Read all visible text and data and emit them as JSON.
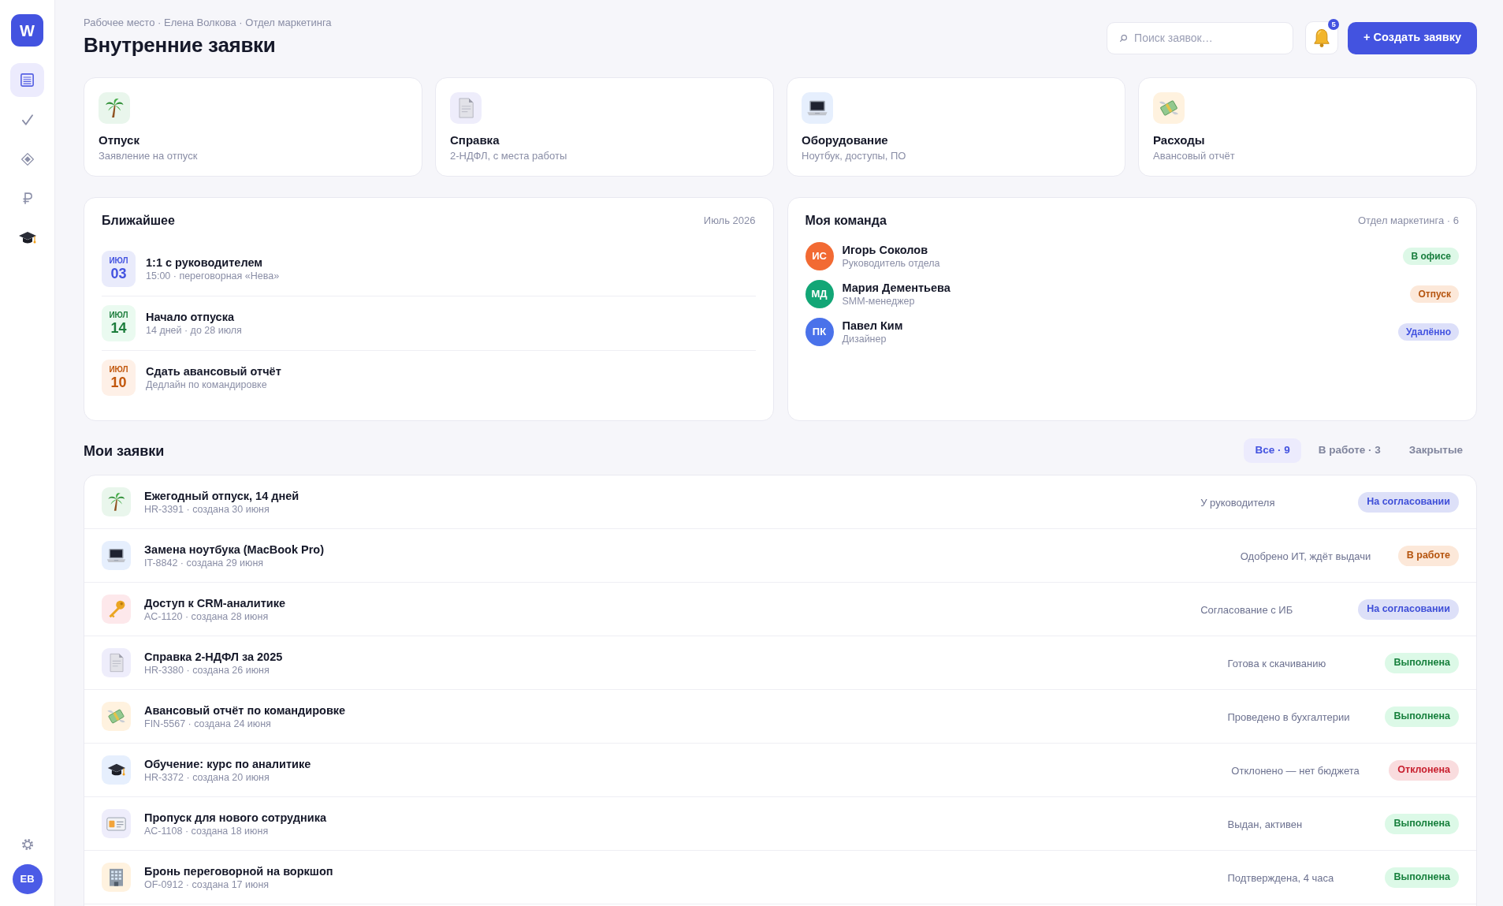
{
  "sidebar": {
    "logo": "W",
    "items": [
      {
        "kind": "list",
        "selected": true
      },
      {
        "kind": "check",
        "selected": false
      },
      {
        "kind": "diamond",
        "selected": false
      },
      {
        "kind": "ruble",
        "selected": false
      },
      {
        "kind": "cap",
        "selected": false
      }
    ],
    "user_initials": "ЕВ"
  },
  "header": {
    "breadcrumb": "Рабочее место · Елена Волкова · Отдел маркетинга",
    "title": "Внутренние заявки",
    "search": {
      "placeholder": "Поиск заявок…"
    },
    "notifications": {
      "count": "5"
    },
    "create_button": "+ Создать заявку"
  },
  "request_types": [
    {
      "kind": "vacation",
      "title": "Отпуск",
      "subtitle": "Заявление на отпуск"
    },
    {
      "kind": "certificate",
      "title": "Справка",
      "subtitle": "2-НДФЛ, с места работы"
    },
    {
      "kind": "equipment",
      "title": "Оборудование",
      "subtitle": "Ноутбук, доступы, ПО"
    },
    {
      "kind": "expense",
      "title": "Расходы",
      "subtitle": "Авансовый отчёт"
    }
  ],
  "upcoming": {
    "title": "Ближайшее",
    "period": "Июль 2026",
    "events": [
      {
        "month": "ИЮЛ",
        "day": "03",
        "color": "#4353e0",
        "title": "1:1 с руководителем",
        "details": "15:00 · переговорная «Нева»"
      },
      {
        "month": "ИЮЛ",
        "day": "14",
        "color": "#1c7d3c",
        "title": "Начало отпуска",
        "details": "14 дней · до 28 июля"
      },
      {
        "month": "ИЮЛ",
        "day": "10",
        "color": "#c2570c",
        "title": "Сдать авансовый отчёт",
        "details": "Дедлайн по командировке"
      }
    ]
  },
  "team": {
    "title": "Моя команда",
    "subtitle": "Отдел маркетинга · 6",
    "members": [
      {
        "initials": "ИС",
        "color": "#f26a33",
        "name": "Игорь Соколов",
        "role": "Руководитель отдела",
        "status": {
          "text": "В офисе",
          "color": "#1a7f3f"
        }
      },
      {
        "initials": "МД",
        "color": "#12a676",
        "name": "Мария Дементьева",
        "role": "SMM-менеджер",
        "status": {
          "text": "Отпуск",
          "color": "#b5540e"
        }
      },
      {
        "initials": "ПК",
        "color": "#4a72ea",
        "name": "Павел Ким",
        "role": "Дизайнер",
        "status": {
          "text": "Удалённо",
          "color": "#4353e0"
        }
      }
    ]
  },
  "my_requests": {
    "title": "Мои заявки",
    "filters": [
      {
        "label": "Все · 9",
        "selected": true
      },
      {
        "label": "В работе · 3",
        "selected": false
      },
      {
        "label": "Закрытые",
        "selected": false
      }
    ],
    "rows": [
      {
        "kind": "vacation",
        "title": "Ежегодный отпуск, 14 дней",
        "meta": "HR-3391 · создана 30 июня",
        "note": "У руководителя",
        "status": {
          "text": "На согласовании",
          "color": "#3f4fd8"
        }
      },
      {
        "kind": "equipment",
        "title": "Замена ноутбука (MacBook Pro)",
        "meta": "IT-8842 · создана 29 июня",
        "note": "Одобрено ИТ, ждёт выдачи",
        "status": {
          "text": "В работе",
          "color": "#b5540e"
        }
      },
      {
        "kind": "access",
        "title": "Доступ к CRM-аналитике",
        "meta": "AC-1120 · создана 28 июня",
        "note": "Согласование с ИБ",
        "status": {
          "text": "На согласовании",
          "color": "#3f4fd8"
        }
      },
      {
        "kind": "certificate",
        "title": "Справка 2-НДФЛ за 2025",
        "meta": "HR-3380 · создана 26 июня",
        "note": "Готова к скачиванию",
        "status": {
          "text": "Выполнена",
          "color": "#17803d"
        }
      },
      {
        "kind": "expense",
        "title": "Авансовый отчёт по командировке",
        "meta": "FIN-5567 · создана 24 июня",
        "note": "Проведено в бухгалтерии",
        "status": {
          "text": "Выполнена",
          "color": "#17803d"
        }
      },
      {
        "kind": "training",
        "title": "Обучение: курс по аналитике",
        "meta": "HR-3372 · создана 20 июня",
        "note": "Отклонено — нет бюджета",
        "status": {
          "text": "Отклонена",
          "color": "#c8202f"
        }
      },
      {
        "kind": "pass",
        "title": "Пропуск для нового сотрудника",
        "meta": "AC-1108 · создана 18 июня",
        "note": "Выдан, активен",
        "status": {
          "text": "Выполнена",
          "color": "#17803d"
        }
      },
      {
        "kind": "office",
        "title": "Бронь переговорной на воркшоп",
        "meta": "OF-0912 · создана 17 июня",
        "note": "Подтверждена, 4 часа",
        "status": {
          "text": "Выполнена",
          "color": "#17803d"
        }
      }
    ]
  }
}
